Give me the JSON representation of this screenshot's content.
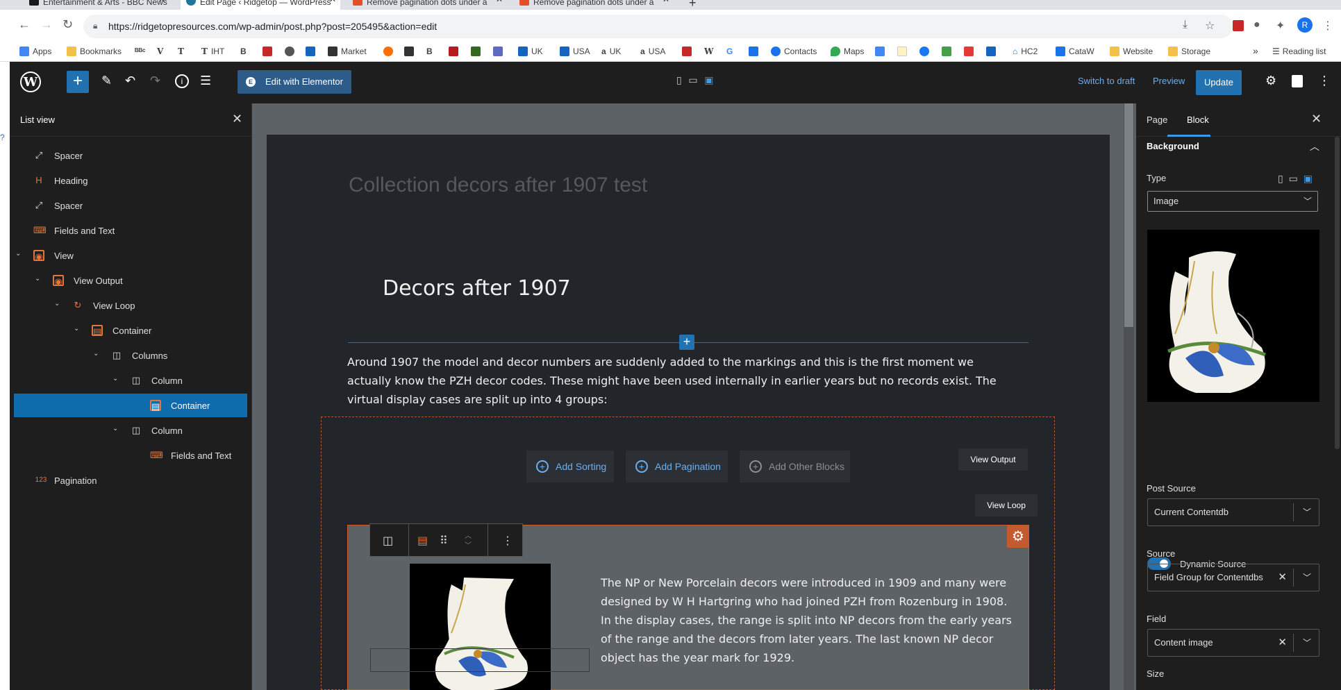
{
  "browser": {
    "tabs": [
      {
        "title": "Entertainment & Arts - BBC News",
        "color": "#1a1a1a"
      },
      {
        "title": "Edit Page ‹ Ridgetop — WordPress",
        "color": "#21759b"
      },
      {
        "title": "Remove pagination dots under a",
        "color": "#e34f26"
      },
      {
        "title": "Remove pagination dots under a",
        "color": "#e34f26"
      }
    ],
    "new_tab": "+",
    "url": "https://ridgetopresources.com/wp-admin/post.php?post=205495&action=edit",
    "profile_initial": "R",
    "bookmarks": [
      {
        "label": "Apps",
        "color": "#4285f4"
      },
      {
        "label": "Bookmarks",
        "color": "#f5c04a"
      },
      {
        "label": "IHT",
        "color": "#222222"
      },
      {
        "label": "Market",
        "color": "#222222"
      },
      {
        "label": "UK",
        "color": "#1565c0"
      },
      {
        "label": "USA",
        "color": "#1565c0"
      },
      {
        "label": "UK",
        "color": "#ff9900"
      },
      {
        "label": "USA",
        "color": "#ff9900"
      },
      {
        "label": "Contacts",
        "color": "#1a73e8"
      },
      {
        "label": "Maps",
        "color": "#34a853"
      },
      {
        "label": "HC2",
        "color": "#1a73e8"
      },
      {
        "label": "CataW",
        "color": "#1a73e8"
      },
      {
        "label": "Website",
        "color": "#f5c04a"
      },
      {
        "label": "Storage",
        "color": "#f5c04a"
      }
    ],
    "bookmarks_more": "»",
    "reading_list": "Reading list"
  },
  "toolbar": {
    "elementor_label": "Edit with Elementor",
    "switch_to_draft": "Switch to draft",
    "preview": "Preview",
    "update": "Update"
  },
  "list_view": {
    "title": "List view",
    "items": [
      {
        "label": "Spacer",
        "icon": "spacer-icon",
        "indent": 0,
        "chevron": false
      },
      {
        "label": "Heading",
        "icon": "heading-icon",
        "indent": 0,
        "chevron": false
      },
      {
        "label": "Spacer",
        "icon": "spacer-icon",
        "indent": 0,
        "chevron": false
      },
      {
        "label": "Fields and Text",
        "icon": "fields-icon",
        "indent": 0,
        "chevron": false
      },
      {
        "label": "View",
        "icon": "view-icon",
        "indent": 0,
        "chevron": true
      },
      {
        "label": "View Output",
        "icon": "view-output-icon",
        "indent": 1,
        "chevron": true
      },
      {
        "label": "View Loop",
        "icon": "view-loop-icon",
        "indent": 2,
        "chevron": true
      },
      {
        "label": "Container",
        "icon": "container-icon",
        "indent": 3,
        "chevron": true
      },
      {
        "label": "Columns",
        "icon": "columns-icon",
        "indent": 4,
        "chevron": true
      },
      {
        "label": "Column",
        "icon": "column-icon",
        "indent": 5,
        "chevron": true
      },
      {
        "label": "Container",
        "icon": "container-icon",
        "indent": 6,
        "chevron": false,
        "selected": true
      },
      {
        "label": "Column",
        "icon": "column-icon",
        "indent": 5,
        "chevron": true
      },
      {
        "label": "Fields and Text",
        "icon": "fields-icon",
        "indent": 6,
        "chevron": false
      },
      {
        "label": "Pagination",
        "icon": "pagination-icon",
        "indent": 0,
        "chevron": false
      }
    ]
  },
  "canvas": {
    "page_title": "Collection decors after 1907 test",
    "heading": "Decors after 1907",
    "intro": "Around 1907 the model and decor numbers are suddenly added to the markings and this is the first moment we actually know the PZH decor codes. These might have been used internally in earlier years but no records exist. The virtual display cases are split up into 4 groups:",
    "add_sorting": "Add Sorting",
    "add_pagination": "Add Pagination",
    "add_other_blocks": "Add Other Blocks",
    "view_output": "View Output",
    "view_loop": "View Loop",
    "np_text": "The NP or New Porcelain decors were introduced in 1909 and many were designed by W H Hartgring who had joined PZH from Rozenburg in 1908. In the display cases, the range is split into NP decors from the early years of the range and the decors from later years. The last known NP decor object has the year mark for 1929."
  },
  "sidebar": {
    "tab_page": "Page",
    "tab_block": "Block",
    "section": "Background",
    "type_label": "Type",
    "type_value": "Image",
    "dynamic_source": "Dynamic Source",
    "post_source_label": "Post Source",
    "post_source_value": "Current Contentdb",
    "source_label": "Source",
    "source_value": "Field Group for Contentdbs",
    "field_label": "Field",
    "field_value": "Content image",
    "size_label": "Size"
  },
  "colors": {
    "accent": "#2271b1",
    "selection": "#0e6cad",
    "block_orange": "#c45a30",
    "icon_orange": "#e3773a",
    "link_blue": "#72aee6"
  }
}
